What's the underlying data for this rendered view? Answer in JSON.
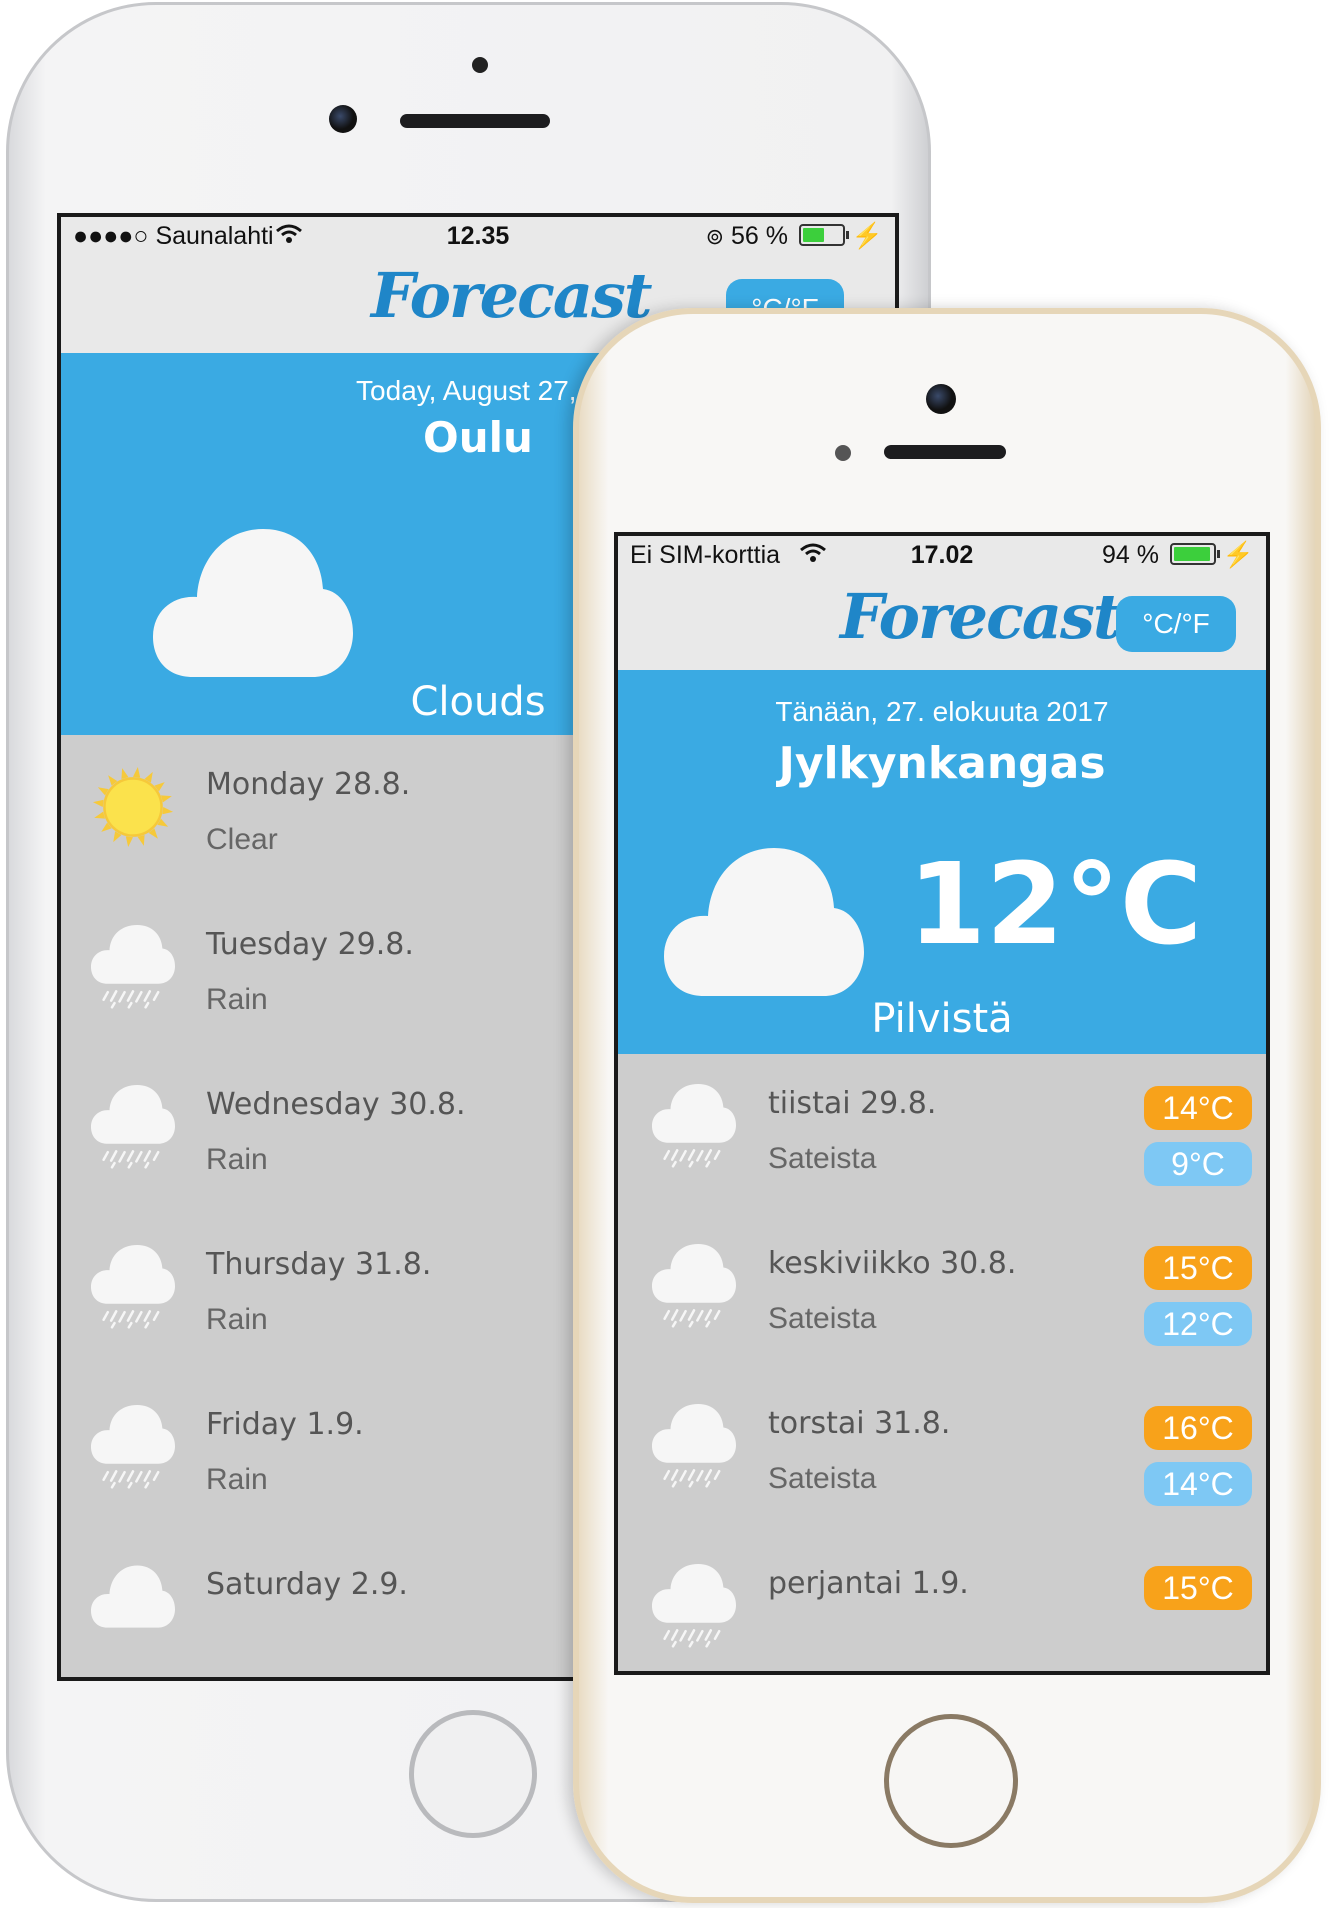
{
  "back_phone": {
    "status": {
      "carrier": "●●●●○ Saunalahti",
      "time": "12.35",
      "battery": "56 %",
      "battery_level": 0.56
    },
    "header": {
      "logo": "Forecast",
      "unit_toggle": "°C/°F"
    },
    "hero": {
      "date": "Today, August 27, 2",
      "city": "Oulu",
      "condition": "Clouds"
    },
    "forecast": [
      {
        "day": "Monday 28.8.",
        "condition": "Clear",
        "icon": "sun-icon"
      },
      {
        "day": "Tuesday 29.8.",
        "condition": "Rain",
        "icon": "rain-cloud-icon"
      },
      {
        "day": "Wednesday 30.8.",
        "condition": "Rain",
        "icon": "rain-cloud-icon"
      },
      {
        "day": "Thursday 31.8.",
        "condition": "Rain",
        "icon": "rain-cloud-icon"
      },
      {
        "day": "Friday 1.9.",
        "condition": "Rain",
        "icon": "rain-cloud-icon"
      },
      {
        "day": "Saturday 2.9.",
        "condition": "",
        "icon": "cloud-icon"
      }
    ]
  },
  "front_phone": {
    "status": {
      "carrier": "Ei SIM-korttia",
      "time": "17.02",
      "battery": "94 %",
      "battery_level": 0.94
    },
    "header": {
      "logo": "Forecast",
      "unit_toggle": "°C/°F"
    },
    "hero": {
      "date": "Tänään, 27. elokuuta 2017",
      "city": "Jylkynkangas",
      "temperature": "12°C",
      "condition": "Pilvistä"
    },
    "forecast": [
      {
        "day": "tiistai 29.8.",
        "condition": "Sateista",
        "high": "14°C",
        "low": "9°C",
        "icon": "rain-cloud-icon"
      },
      {
        "day": "keskiviikko 30.8.",
        "condition": "Sateista",
        "high": "15°C",
        "low": "12°C",
        "icon": "rain-cloud-icon"
      },
      {
        "day": "torstai 31.8.",
        "condition": "Sateista",
        "high": "16°C",
        "low": "14°C",
        "icon": "rain-cloud-icon"
      },
      {
        "day": "perjantai 1.9.",
        "condition": "",
        "high": "15°C",
        "low": "",
        "icon": "rain-cloud-icon"
      }
    ]
  },
  "colors": {
    "accent": "#3aaae3",
    "logo": "#1f86c8",
    "high_temp": "#f8a21a",
    "low_temp": "#7ec8f4"
  }
}
